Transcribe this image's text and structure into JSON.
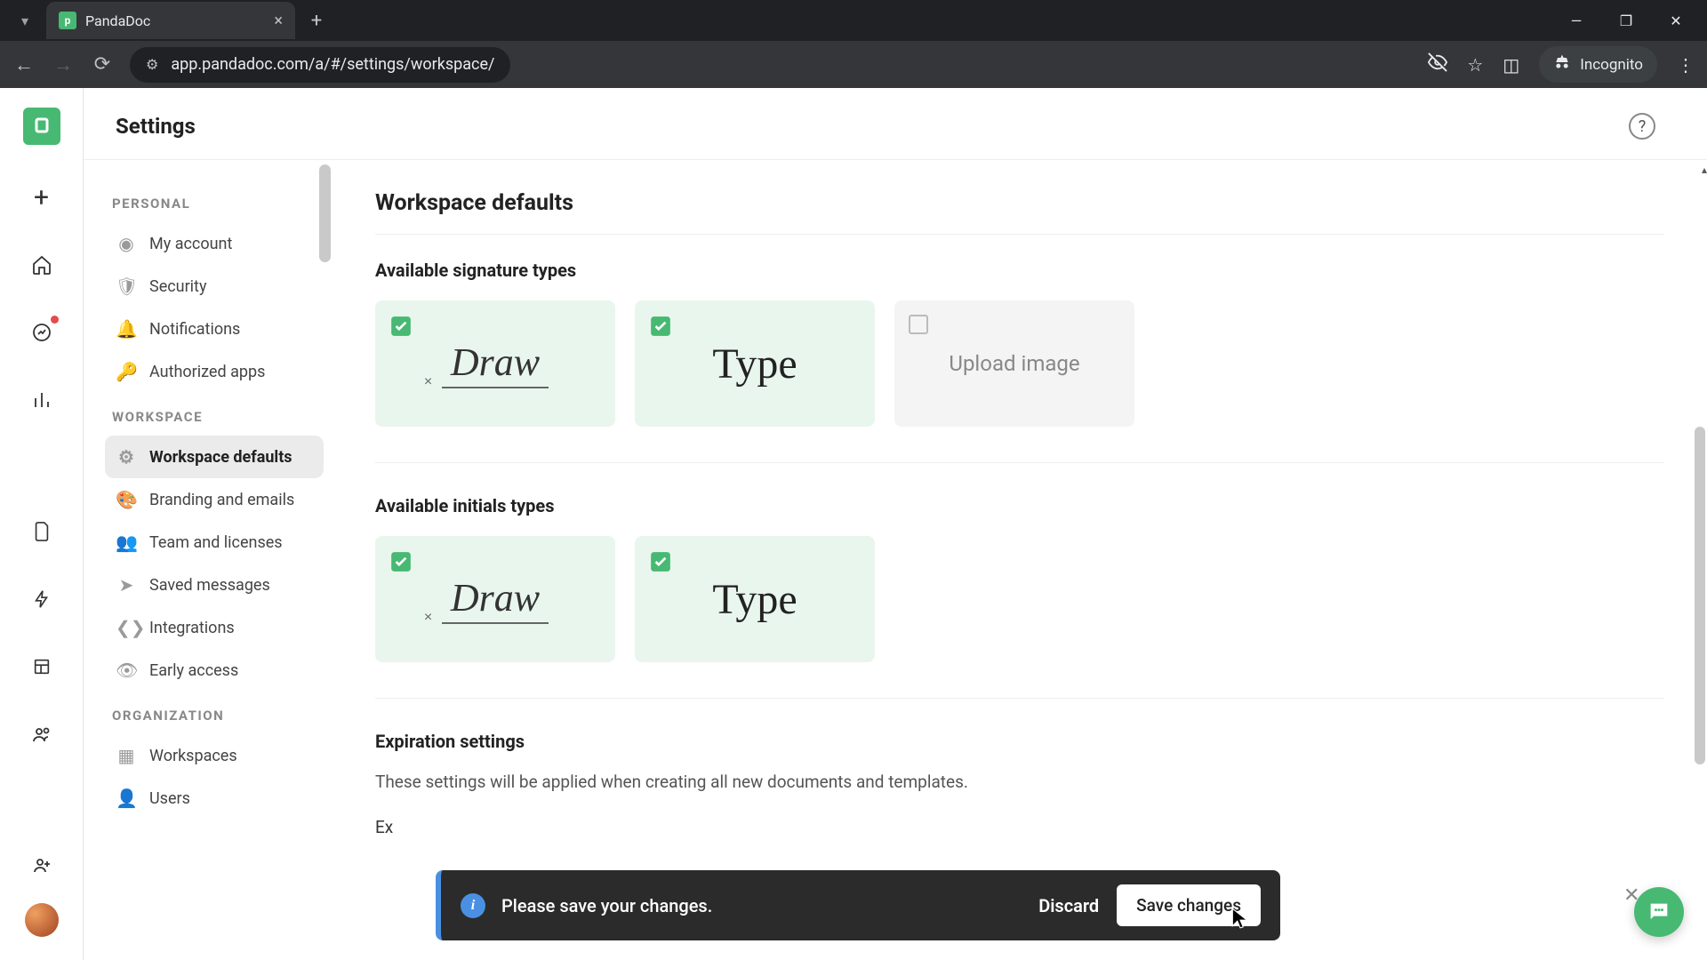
{
  "browser": {
    "tab_title": "PandaDoc",
    "url": "app.pandadoc.com/a/#/settings/workspace/",
    "incognito_label": "Incognito"
  },
  "header": {
    "title": "Settings"
  },
  "nav": {
    "groups": [
      {
        "label": "PERSONAL",
        "items": [
          {
            "label": "My account"
          },
          {
            "label": "Security"
          },
          {
            "label": "Notifications"
          },
          {
            "label": "Authorized apps"
          }
        ]
      },
      {
        "label": "WORKSPACE",
        "items": [
          {
            "label": "Workspace defaults",
            "active": true
          },
          {
            "label": "Branding and emails"
          },
          {
            "label": "Team and licenses"
          },
          {
            "label": "Saved messages"
          },
          {
            "label": "Integrations"
          },
          {
            "label": "Early access"
          }
        ]
      },
      {
        "label": "ORGANIZATION",
        "items": [
          {
            "label": "Workspaces"
          },
          {
            "label": "Users"
          }
        ]
      }
    ]
  },
  "main": {
    "title": "Workspace defaults",
    "signature_section": "Available signature types",
    "initials_section": "Available initials types",
    "signature_types": {
      "draw": "Draw",
      "type": "Type",
      "upload": "Upload image"
    },
    "expiration": {
      "title": "Expiration settings",
      "desc": "These settings will be applied when creating all new documents and templates.",
      "prefix": "Ex"
    }
  },
  "toast": {
    "msg": "Please save your changes.",
    "discard": "Discard",
    "save": "Save changes"
  }
}
